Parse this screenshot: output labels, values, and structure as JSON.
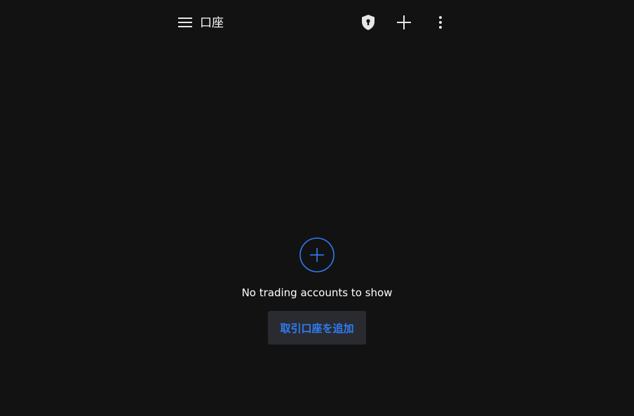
{
  "appbar": {
    "title": "口座",
    "icons": {
      "menu": "menu-icon",
      "shield": "shield-keyhole-icon",
      "add": "plus-icon",
      "more": "more-vertical-icon"
    }
  },
  "empty_state": {
    "icon": "plus-circle-icon",
    "message": "No trading accounts to show",
    "button_label": "取引口座を追加"
  },
  "colors": {
    "background": "#121212",
    "accent": "#2f7cf6",
    "button_background": "#2a2b30",
    "icon": "#e6e6e6"
  }
}
